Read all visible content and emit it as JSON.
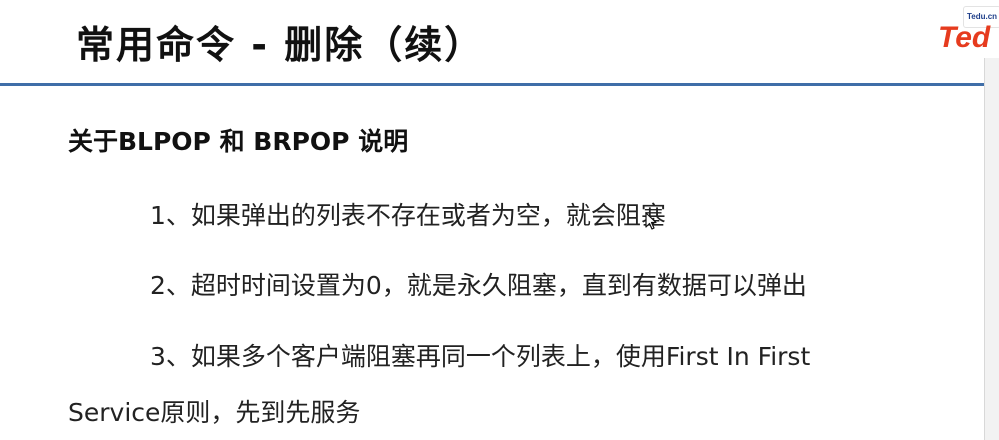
{
  "slide": {
    "title": "常用命令 - 删除（续）",
    "logo": {
      "badge_text": "Tedu.cn",
      "wordmark": "Ted"
    },
    "heading": "关于BLPOP 和 BRPOP 说明",
    "points": [
      "1、如果弹出的列表不存在或者为空，就会阻塞",
      "2、超时时间设置为0，就是永久阻塞，直到有数据可以弹出",
      "3、如果多个客户端阻塞再同一个列表上，使用First In First",
      "Service原则，先到先服务"
    ]
  },
  "colors": {
    "title_rule": "#3f6ea8",
    "logo_red": "#e63b1e",
    "logo_blue": "#1f3f8a"
  },
  "icons": {
    "cursor": "mouse-pointer-icon"
  }
}
